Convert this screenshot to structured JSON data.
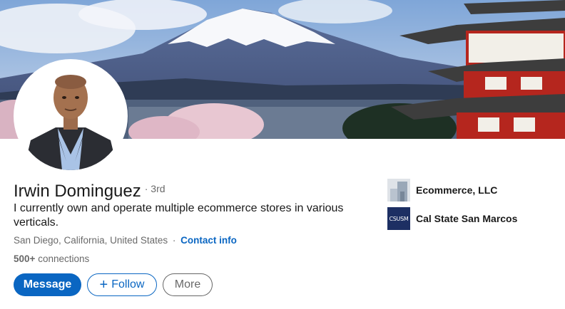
{
  "profile": {
    "name": "Irwin Dominguez",
    "degree": "3rd",
    "headline": "I currently own and operate multiple ecommerce stores in various verticals.",
    "location": "San Diego, California, United States",
    "location_separator": "·",
    "contact_info": "Contact info",
    "connections_count": "500+",
    "connections_label": "connections"
  },
  "actions": {
    "message": "Message",
    "follow_plus": "+",
    "follow": "Follow",
    "more": "More"
  },
  "organizations": [
    {
      "name": "Ecommerce, LLC",
      "icon": "company-placeholder-icon"
    },
    {
      "name": "Cal State San Marcos",
      "icon": "csusm-logo",
      "logo_text": "CSUSM"
    }
  ],
  "colors": {
    "accent": "#0a66c2",
    "csusm_blue": "#1d2f63"
  },
  "banner": {
    "image": "mount-fuji-pagoda-banner"
  }
}
